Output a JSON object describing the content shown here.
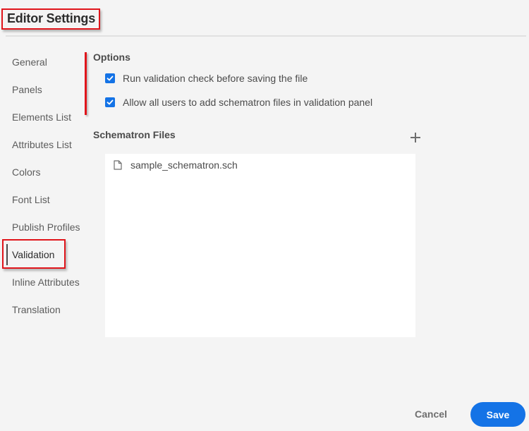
{
  "header": {
    "title": "Editor Settings"
  },
  "sidebar": {
    "items": [
      {
        "label": "General"
      },
      {
        "label": "Panels"
      },
      {
        "label": "Elements List"
      },
      {
        "label": "Attributes List"
      },
      {
        "label": "Colors"
      },
      {
        "label": "Font List"
      },
      {
        "label": "Publish Profiles"
      },
      {
        "label": "Validation",
        "selected": true
      },
      {
        "label": "Inline Attributes"
      },
      {
        "label": "Translation"
      }
    ]
  },
  "main": {
    "options": {
      "title": "Options",
      "items": [
        {
          "label": "Run validation check before saving the file",
          "checked": true
        },
        {
          "label": "Allow all users to add schematron files in validation panel",
          "checked": true
        }
      ]
    },
    "schematron": {
      "title": "Schematron Files",
      "add_icon": "plus-icon",
      "files": [
        {
          "name": "sample_schematron.sch",
          "icon": "file-icon"
        }
      ]
    }
  },
  "footer": {
    "cancel_label": "Cancel",
    "save_label": "Save"
  },
  "colors": {
    "accent": "#1473e6",
    "highlight": "#e0151b",
    "background": "#f4f4f4"
  }
}
